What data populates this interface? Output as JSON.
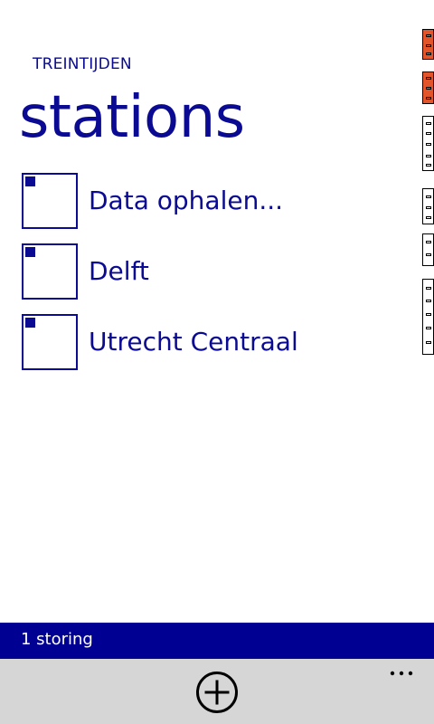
{
  "app": {
    "title": "TREINTIJDEN",
    "page_title": "stations"
  },
  "stations": {
    "items": [
      {
        "label": "Data ophalen..."
      },
      {
        "label": "Delft"
      },
      {
        "label": "Utrecht Centraal"
      }
    ]
  },
  "status_bar": {
    "text": "1 storing",
    "color": "#000092"
  },
  "app_bar": {
    "add_icon": "add-circle-icon",
    "more_icon": "ellipsis-icon",
    "background": "#d6d6d6"
  },
  "theme": {
    "accent": "#0a0a92",
    "background": "#ffffff"
  },
  "debug_counters": {
    "icon": "frame-rate-counter-icon"
  }
}
